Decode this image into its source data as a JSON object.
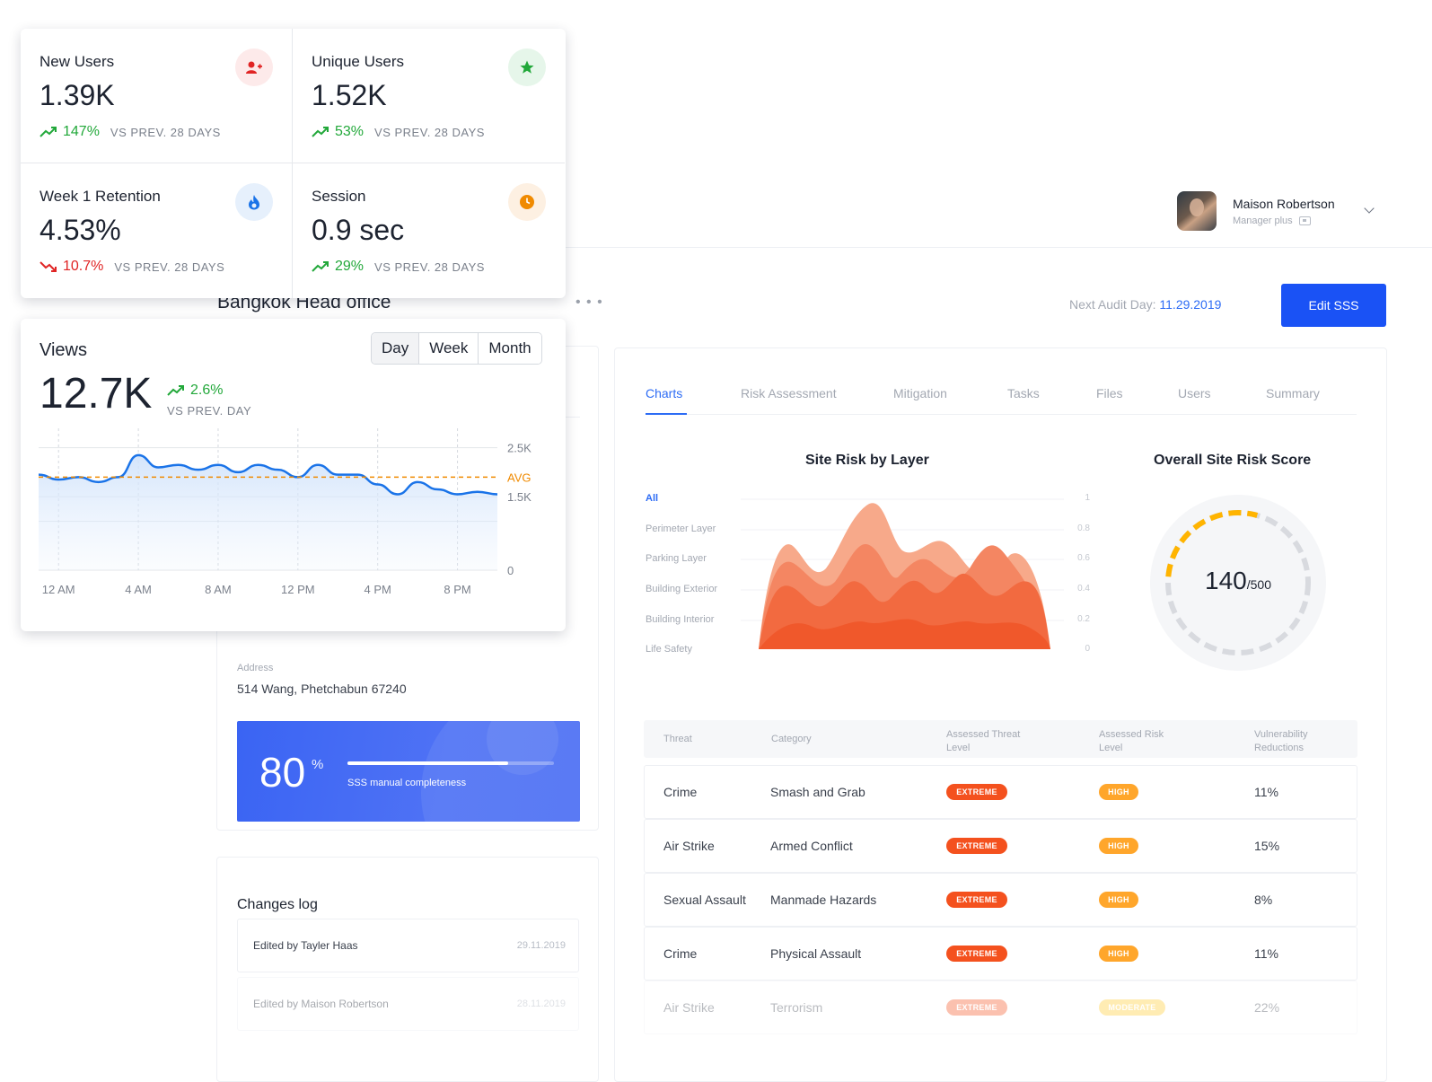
{
  "header": {
    "title_tail": "e",
    "user": {
      "name": "Maison Robertson",
      "role": "Manager plus"
    }
  },
  "site": {
    "title": "Bangkok Head office",
    "audit_label": "Next Audit Day: ",
    "audit_date": "11.29.2019",
    "edit_button": "Edit SSS",
    "address_label": "Address",
    "address_value": "514 Wang, Phetchabun 67240",
    "completeness": {
      "value": "80",
      "unit": "%",
      "label": "SSS manual completeness",
      "fraction": 0.78
    }
  },
  "changes_log": {
    "title": "Changes log",
    "items": [
      {
        "who": "Edited by Tayler Haas",
        "when": "29.11.2019"
      },
      {
        "who": "Edited by Maison Robertson",
        "when": "28.11.2019"
      }
    ]
  },
  "tabs": [
    "Charts",
    "Risk Assessment",
    "Mitigation",
    "Tasks",
    "Files",
    "Users",
    "Summary"
  ],
  "risk_layer_chart": {
    "title": "Site Risk by Layer",
    "layers": [
      "All",
      "Perimeter Layer",
      "Parking Layer",
      "Building Exterior",
      "Building Interior",
      "Life Safety"
    ],
    "ticks": [
      "1",
      "0.8",
      "0.6",
      "0.4",
      "0.2",
      "0"
    ]
  },
  "risk_score": {
    "title": "Overall Site Risk Score",
    "value": "140",
    "max": "/500",
    "fraction": 0.28
  },
  "threat_table": {
    "headers": [
      "Threat",
      "Category",
      "Assessed Threat\nLevel",
      "Assessed Risk\nLevel",
      "Vulnerability\nReductions"
    ],
    "rows": [
      {
        "threat": "Crime",
        "category": "Smash and Grab",
        "threat_level": "EXTREME",
        "risk_level": "HIGH",
        "reduction": "11%"
      },
      {
        "threat": "Air Strike",
        "category": "Armed Conflict",
        "threat_level": "EXTREME",
        "risk_level": "HIGH",
        "reduction": "15%"
      },
      {
        "threat": "Sexual Assault",
        "category": "Manmade Hazards",
        "threat_level": "EXTREME",
        "risk_level": "HIGH",
        "reduction": "8%"
      },
      {
        "threat": "Crime",
        "category": "Physical Assault",
        "threat_level": "EXTREME",
        "risk_level": "HIGH",
        "reduction": "11%"
      },
      {
        "threat": "Air Strike",
        "category": "Terrorism",
        "threat_level": "EXTREME",
        "risk_level": "MODERATE",
        "reduction": "22%"
      }
    ]
  },
  "stats": [
    {
      "label": "New Users",
      "value": "1.39K",
      "change": "147%",
      "trend": "up",
      "compare": "VS PREV. 28 DAYS",
      "icon": "add-user-icon",
      "icon_color": "#e02424",
      "icon_bg": "#fdeaea"
    },
    {
      "label": "Unique Users",
      "value": "1.52K",
      "change": "53%",
      "trend": "up",
      "compare": "VS PREV. 28 DAYS",
      "icon": "star-icon",
      "icon_color": "#22a83a",
      "icon_bg": "#e6f6ea"
    },
    {
      "label": "Week 1 Retention",
      "value": "4.53%",
      "change": "10.7%",
      "trend": "down",
      "compare": "VS PREV. 28 DAYS",
      "icon": "fire-icon",
      "icon_color": "#1a73e8",
      "icon_bg": "#e6f0fc"
    },
    {
      "label": "Session",
      "value": "0.9 sec",
      "change": "29%",
      "trend": "up",
      "compare": "VS PREV. 28 DAYS",
      "icon": "clock-icon",
      "icon_color": "#f08a00",
      "icon_bg": "#fdf0e2"
    }
  ],
  "views": {
    "title": "Views",
    "value": "12.7K",
    "change": "2.6%",
    "compare": "VS PREV. DAY",
    "ranges": [
      "Day",
      "Week",
      "Month"
    ],
    "selected_range": "Day"
  },
  "chart_data": {
    "type": "area",
    "title": "",
    "x": [
      "12 AM",
      "1 AM",
      "2 AM",
      "3 AM",
      "4 AM",
      "5 AM",
      "6 AM",
      "7 AM",
      "8 AM",
      "9 AM",
      "10 AM",
      "11 AM",
      "12 PM",
      "1 PM",
      "2 PM",
      "3 PM",
      "4 PM",
      "5 PM",
      "6 PM",
      "7 PM",
      "8 PM",
      "9 PM",
      "10 PM",
      "11 PM"
    ],
    "xticks": [
      "12 AM",
      "4 AM",
      "8 AM",
      "12 PM",
      "4 PM",
      "8 PM"
    ],
    "series": [
      {
        "values": [
          1950,
          1850,
          1900,
          1800,
          1900,
          2350,
          2100,
          2150,
          2050,
          2150,
          2000,
          2150,
          2050,
          1900,
          2150,
          1950,
          1950,
          1750,
          1550,
          1800,
          1650,
          1550,
          1600,
          1550
        ]
      }
    ],
    "avg": 1900,
    "avg_label": "AVG",
    "yticks": [
      "2.5K",
      "1.5K",
      "0"
    ],
    "ylim": [
      0,
      2750
    ],
    "colors": {
      "line": "#1a73e8",
      "avg": "#f08a00"
    }
  },
  "colors": {
    "accent": "#1a52f5",
    "extreme": "#f4511e",
    "high": "#ffa62b",
    "moderate": "#ffca28",
    "up": "#22a83a",
    "down": "#e02424"
  }
}
